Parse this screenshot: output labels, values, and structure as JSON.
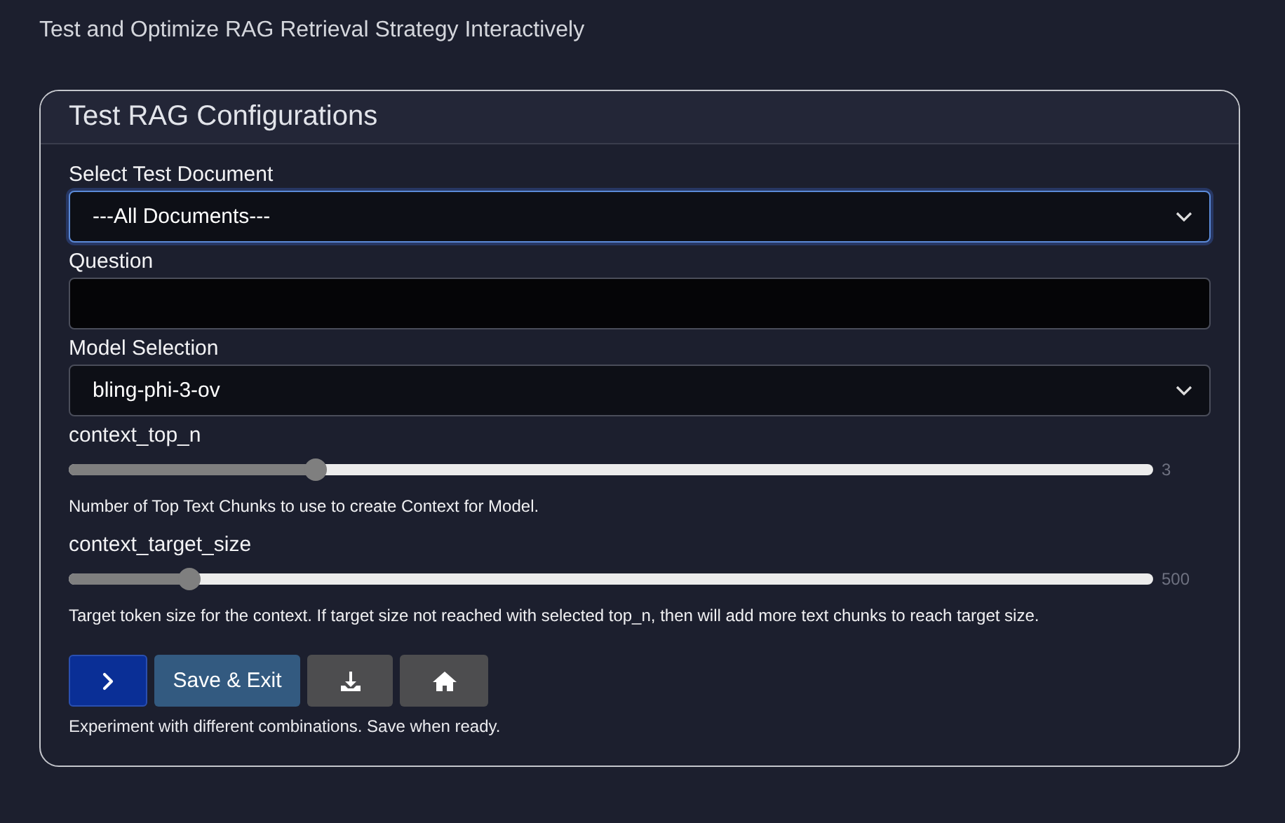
{
  "subtitle": "Test and Optimize RAG Retrieval Strategy Interactively",
  "card": {
    "title": "Test RAG Configurations",
    "fields": [
      {
        "kind": "select",
        "label": "Select Test Document",
        "value": "---All Documents---",
        "focused": true
      },
      {
        "kind": "input",
        "label": "Question",
        "focused": false
      },
      {
        "kind": "select",
        "label": "Model Selection",
        "value": "bling-phi-3-ov",
        "focused": false
      },
      {
        "kind": "slider",
        "label": "context_top_n",
        "level": 0.228,
        "reading": "3",
        "help": "Number of Top Text Chunks to use to create Context for Model."
      },
      {
        "kind": "slider",
        "label": "context_target_size",
        "level": 0.111,
        "reading": "500",
        "help": "Target token size for the context. If target size not reached with selected top_n, then will add more text chunks to reach target size."
      }
    ],
    "buttons": [
      {
        "kind": "next"
      },
      {
        "kind": "text",
        "label": "Save & Exit"
      },
      {
        "kind": "download"
      },
      {
        "kind": "home"
      }
    ],
    "footer": "Experiment with different combinations. Save when ready."
  }
}
